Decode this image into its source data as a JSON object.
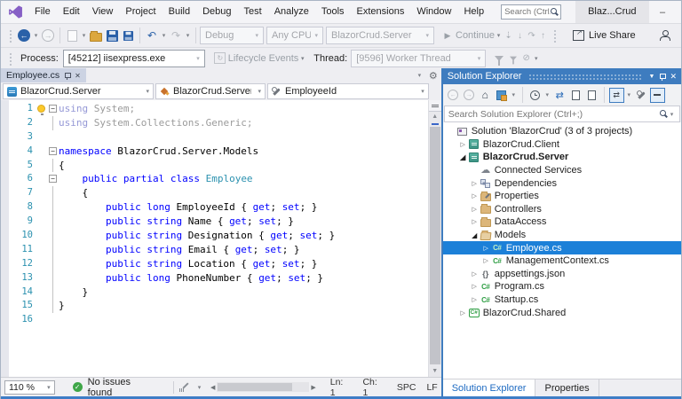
{
  "colors": {
    "accent_blue": "#3e7cbf",
    "selection_blue": "#1c80d8",
    "keyword": "#0000ff",
    "type_name": "#2b91af",
    "line_number": "#2b91af"
  },
  "titlebar": {
    "menus": [
      "File",
      "Edit",
      "View",
      "Project",
      "Build",
      "Debug",
      "Test",
      "Analyze",
      "Tools",
      "Extensions",
      "Window",
      "Help"
    ],
    "search_placeholder": "Search (Ctrl...",
    "window_title": "Blaz...Crud"
  },
  "toolbar": {
    "debug_config": "Debug",
    "platform": "Any CPU",
    "startup_project": "BlazorCrud.Server",
    "continue_label": "Continue",
    "live_share_label": "Live Share"
  },
  "process_bar": {
    "process_label": "Process:",
    "process_value": "[45212] iisexpress.exe",
    "lifecycle_label": "Lifecycle Events",
    "thread_label": "Thread:",
    "thread_value": "[9596] Worker Thread"
  },
  "editor": {
    "tab_title": "Employee.cs",
    "nav": {
      "project": "BlazorCrud.Server",
      "type": "BlazorCrud.Server.Models.Emplo",
      "member": "EmployeeId"
    },
    "code": {
      "lines": [
        {
          "n": 1,
          "bulb": true,
          "fold": "box",
          "tk": [
            [
              "kd",
              "using"
            ],
            [
              "pd",
              " System;"
            ]
          ]
        },
        {
          "n": 2,
          "fold": "line",
          "tk": [
            [
              "kd",
              "using"
            ],
            [
              "pd",
              " System.Collections.Generic;"
            ]
          ]
        },
        {
          "n": 3,
          "fold": "",
          "tk": []
        },
        {
          "n": 4,
          "fold": "box",
          "tk": [
            [
              "k",
              "namespace"
            ],
            [
              "p",
              " BlazorCrud.Server.Models"
            ]
          ]
        },
        {
          "n": 5,
          "fold": "line",
          "tk": [
            [
              "p",
              "{"
            ]
          ]
        },
        {
          "n": 6,
          "fold": "box",
          "tk": [
            [
              "p",
              "    "
            ],
            [
              "k",
              "public partial class "
            ],
            [
              "t",
              "Employee"
            ]
          ]
        },
        {
          "n": 7,
          "fold": "line",
          "tk": [
            [
              "p",
              "    {"
            ]
          ]
        },
        {
          "n": 8,
          "fold": "line",
          "tk": [
            [
              "p",
              "        "
            ],
            [
              "k",
              "public long"
            ],
            [
              "p",
              " EmployeeId { "
            ],
            [
              "k",
              "get"
            ],
            [
              "p",
              "; "
            ],
            [
              "k",
              "set"
            ],
            [
              "p",
              "; }"
            ]
          ]
        },
        {
          "n": 9,
          "fold": "line",
          "tk": [
            [
              "p",
              "        "
            ],
            [
              "k",
              "public string"
            ],
            [
              "p",
              " Name { "
            ],
            [
              "k",
              "get"
            ],
            [
              "p",
              "; "
            ],
            [
              "k",
              "set"
            ],
            [
              "p",
              "; }"
            ]
          ]
        },
        {
          "n": 10,
          "fold": "line",
          "tk": [
            [
              "p",
              "        "
            ],
            [
              "k",
              "public string"
            ],
            [
              "p",
              " Designation { "
            ],
            [
              "k",
              "get"
            ],
            [
              "p",
              "; "
            ],
            [
              "k",
              "set"
            ],
            [
              "p",
              "; }"
            ]
          ]
        },
        {
          "n": 11,
          "fold": "line",
          "tk": [
            [
              "p",
              "        "
            ],
            [
              "k",
              "public string"
            ],
            [
              "p",
              " Email { "
            ],
            [
              "k",
              "get"
            ],
            [
              "p",
              "; "
            ],
            [
              "k",
              "set"
            ],
            [
              "p",
              "; }"
            ]
          ]
        },
        {
          "n": 12,
          "fold": "line",
          "tk": [
            [
              "p",
              "        "
            ],
            [
              "k",
              "public string"
            ],
            [
              "p",
              " Location { "
            ],
            [
              "k",
              "get"
            ],
            [
              "p",
              "; "
            ],
            [
              "k",
              "set"
            ],
            [
              "p",
              "; }"
            ]
          ]
        },
        {
          "n": 13,
          "fold": "line",
          "tk": [
            [
              "p",
              "        "
            ],
            [
              "k",
              "public long"
            ],
            [
              "p",
              " PhoneNumber { "
            ],
            [
              "k",
              "get"
            ],
            [
              "p",
              "; "
            ],
            [
              "k",
              "set"
            ],
            [
              "p",
              "; }"
            ]
          ]
        },
        {
          "n": 14,
          "fold": "line",
          "tk": [
            [
              "p",
              "    }"
            ]
          ]
        },
        {
          "n": 15,
          "fold": "line",
          "tk": [
            [
              "p",
              "}"
            ]
          ]
        },
        {
          "n": 16,
          "fold": "",
          "tk": []
        }
      ]
    },
    "status": {
      "zoom": "110 %",
      "issues": "No issues found",
      "line": "Ln: 1",
      "column": "Ch: 1",
      "spaces": "SPC",
      "eol": "LF"
    }
  },
  "solution_explorer": {
    "title": "Solution Explorer",
    "search_placeholder": "Search Solution Explorer (Ctrl+;)",
    "tree": [
      {
        "indent": 0,
        "arrow": "",
        "icon": "solution",
        "label": "Solution 'BlazorCrud' (3 of 3 projects)"
      },
      {
        "indent": 1,
        "arrow": "c",
        "icon": "project",
        "label": "BlazorCrud.Client"
      },
      {
        "indent": 1,
        "arrow": "e",
        "icon": "project",
        "label": "BlazorCrud.Server",
        "bold": true
      },
      {
        "indent": 2,
        "arrow": "",
        "icon": "cloud",
        "label": "Connected Services"
      },
      {
        "indent": 2,
        "arrow": "c",
        "icon": "deps",
        "label": "Dependencies"
      },
      {
        "indent": 2,
        "arrow": "c",
        "icon": "folder-props",
        "label": "Properties"
      },
      {
        "indent": 2,
        "arrow": "c",
        "icon": "folder",
        "label": "Controllers"
      },
      {
        "indent": 2,
        "arrow": "c",
        "icon": "folder",
        "label": "DataAccess"
      },
      {
        "indent": 2,
        "arrow": "e",
        "icon": "folder-open",
        "label": "Models"
      },
      {
        "indent": 3,
        "arrow": "c",
        "icon": "cs",
        "label": "Employee.cs",
        "selected": true
      },
      {
        "indent": 3,
        "arrow": "c",
        "icon": "cs",
        "label": "ManagementContext.cs"
      },
      {
        "indent": 2,
        "arrow": "c",
        "icon": "json",
        "label": "appsettings.json"
      },
      {
        "indent": 2,
        "arrow": "c",
        "icon": "cs",
        "label": "Program.cs"
      },
      {
        "indent": 2,
        "arrow": "c",
        "icon": "cs",
        "label": "Startup.cs"
      },
      {
        "indent": 1,
        "arrow": "c",
        "icon": "csproj",
        "label": "BlazorCrud.Shared"
      }
    ],
    "tabs": [
      "Solution Explorer",
      "Properties"
    ]
  }
}
